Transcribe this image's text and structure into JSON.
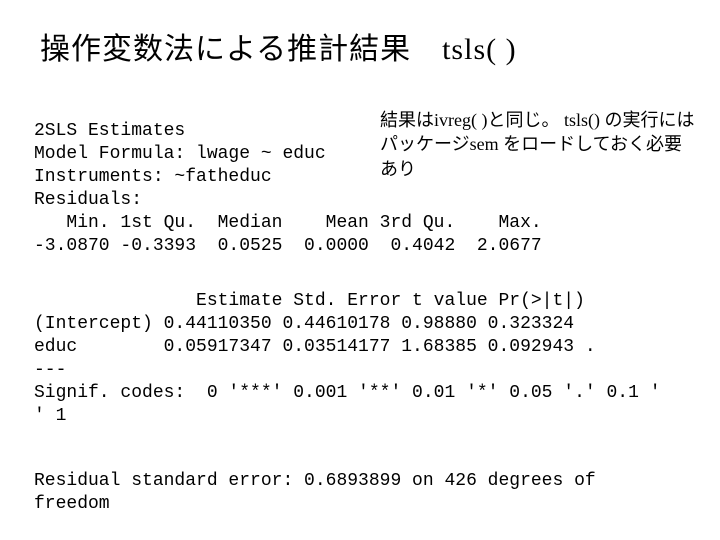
{
  "title": "操作変数法による推計結果　tsls( )",
  "note": "結果はivreg( )と同じ。\ntsls() の実行にはパッケージsem\nをロードしておく必要あり",
  "header_lines": [
    "2SLS Estimates",
    "Model Formula: lwage ~ educ",
    "Instruments: ~fatheduc",
    "Residuals:",
    "   Min. 1st Qu.  Median    Mean 3rd Qu.    Max.",
    "-3.0870 -0.3393  0.0525  0.0000  0.4042  2.0677"
  ],
  "coef_lines": [
    "               Estimate Std. Error t value Pr(>|t|)",
    "(Intercept) 0.44110350 0.44610178 0.98880 0.323324",
    "educ        0.05917347 0.03514177 1.68385 0.092943 .",
    "---",
    "Signif. codes:  0 '***' 0.001 '**' 0.01 '*' 0.05 '.' 0.1 '",
    "' 1"
  ],
  "footer": "Residual standard error: 0.6893899 on 426 degrees of\nfreedom"
}
